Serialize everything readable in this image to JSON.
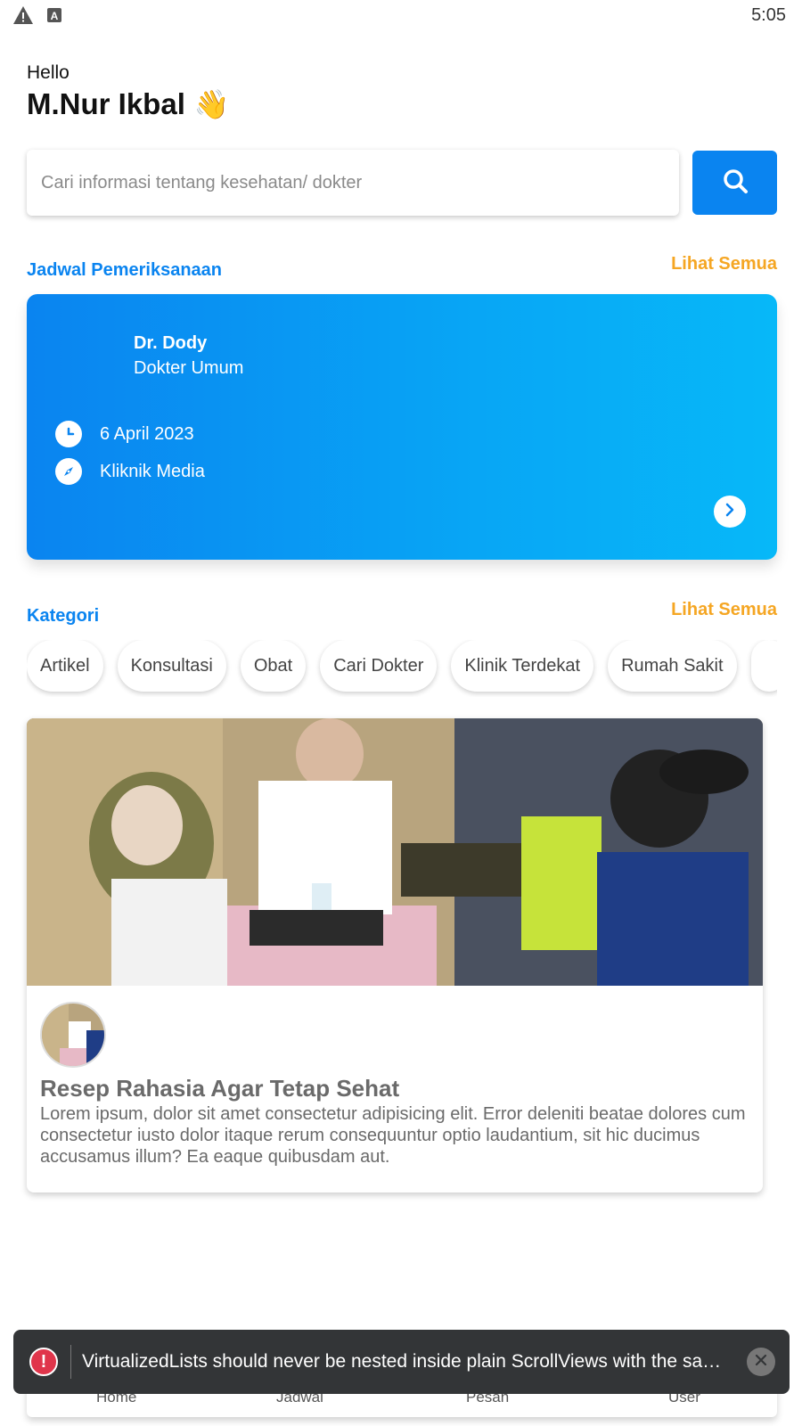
{
  "status_bar": {
    "time": "5:05",
    "icons": [
      "warning-icon",
      "a-notification-icon"
    ]
  },
  "greeting": {
    "hello": "Hello",
    "name": "M.Nur Ikbal",
    "emoji": "👋"
  },
  "search": {
    "placeholder": "Cari informasi tentang kesehatan/ dokter",
    "value": "",
    "button_icon": "search-icon"
  },
  "schedule": {
    "title": "Jadwal Pemeriksanaan",
    "see_all": "Lihat Semua",
    "card": {
      "doctor_name": "Dr. Dody",
      "doctor_role": "Dokter Umum",
      "date": "6 April 2023",
      "location": "Kliknik Media",
      "date_icon": "clock-icon",
      "location_icon": "compass-icon",
      "arrow_icon": "chevron-right-icon"
    }
  },
  "categories": {
    "title": "Kategori",
    "see_all": "Lihat Semua",
    "items": [
      "Artikel",
      "Konsultasi",
      "Obat",
      "Cari Dokter",
      "Klinik Terdekat",
      "Rumah Sakit"
    ]
  },
  "article": {
    "title": "Resep Rahasia Agar Tetap Sehat",
    "body": "Lorem ipsum, dolor sit amet consectetur adipisicing elit. Error deleniti beatae dolores cum consectetur iusto dolor itaque rerum consequuntur optio laudantium, sit hic ducimus accusamus illum? Ea eaque quibusdam aut."
  },
  "bottom_nav": {
    "items": [
      "Home",
      "Jadwal",
      "Pesan",
      "User"
    ]
  },
  "toast": {
    "message": "VirtualizedLists should never be nested inside plain ScrollViews with the sam…",
    "icon": "error-icon",
    "close_icon": "close-icon"
  },
  "colors": {
    "primary": "#0a84f0",
    "accent": "#f5a623",
    "toast_bg": "#333537",
    "error": "#e0354b"
  }
}
